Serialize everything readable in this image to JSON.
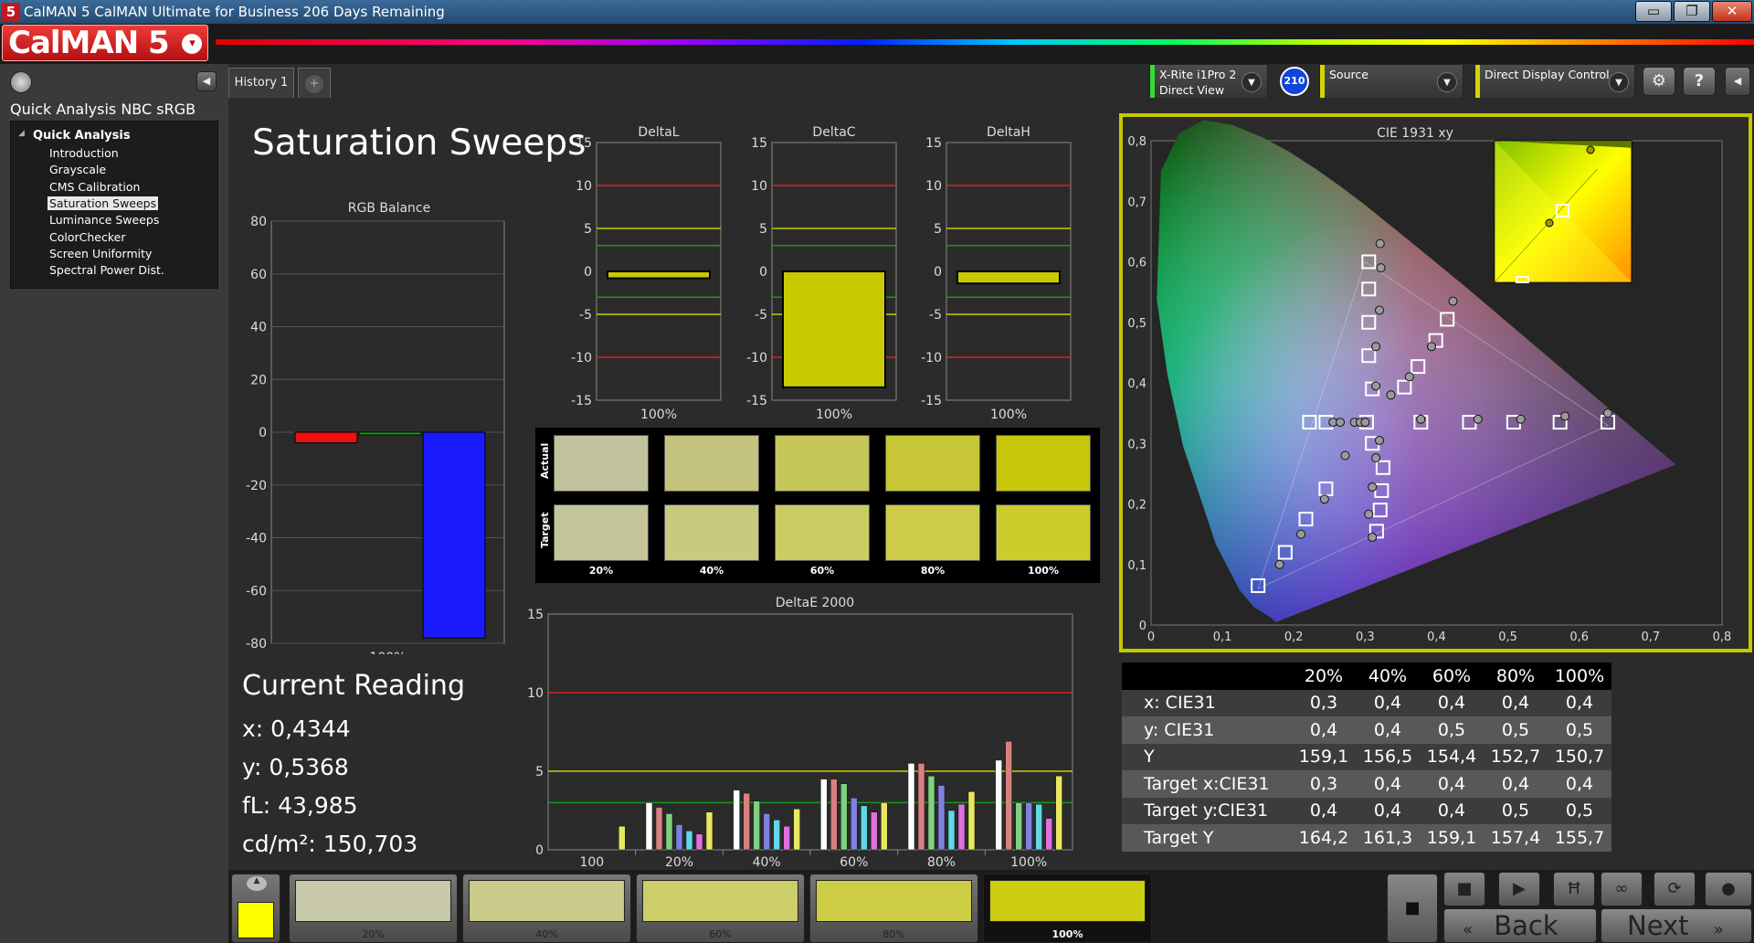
{
  "window": {
    "title": "CalMAN 5 CalMAN Ultimate for Business 206 Days Remaining",
    "app_icon": "5",
    "min": "▭",
    "max": "❐",
    "close": "✕"
  },
  "brand": {
    "logo": "CalMAN 5",
    "menu_glyph": "▾"
  },
  "left_panel": {
    "workflow_title": "Quick Analysis NBC sRGB",
    "tree_root": "Quick Analysis",
    "items": [
      "Introduction",
      "Grayscale",
      "CMS Calibration",
      "Saturation Sweeps",
      "Luminance Sweeps",
      "ColorChecker",
      "Screen Uniformity",
      "Spectral Power Dist."
    ],
    "selected_index": 3
  },
  "tabs": {
    "history": "History 1",
    "add": "+"
  },
  "top_controls": {
    "meter_line1": "X-Rite i1Pro 2",
    "meter_line2": "Direct View",
    "meter_badge": "210",
    "source": "Source",
    "display": "Direct Display Control",
    "stripe_color": "#c7ff00"
  },
  "page_title": "Saturation Sweeps",
  "rgb_balance": {
    "title": "RGB Balance",
    "ticks": [
      "80",
      "60",
      "40",
      "20",
      "0",
      "-20",
      "-40",
      "-60",
      "-80"
    ],
    "xlabel": "100%",
    "values": {
      "red": -4,
      "green": -1,
      "blue": -78
    }
  },
  "delta_charts": [
    {
      "title": "DeltaL",
      "xlabel": "100%",
      "value": -0.8
    },
    {
      "title": "DeltaC",
      "xlabel": "100%",
      "value": -13.5
    },
    {
      "title": "DeltaH",
      "xlabel": "100%",
      "value": -1.4
    }
  ],
  "delta_ticks": [
    "15",
    "10",
    "5",
    "0",
    "-5",
    "-10",
    "-15"
  ],
  "swatches": {
    "actual_label": "Actual",
    "target_label": "Target",
    "labels": [
      "20%",
      "40%",
      "60%",
      "80%",
      "100%"
    ],
    "actual_colors": [
      "#c2c29c",
      "#c3c37d",
      "#c6c65b",
      "#c6c637",
      "#c7c70c"
    ],
    "target_colors": [
      "#c5c59a",
      "#c9c980",
      "#cccc65",
      "#cccc48",
      "#cccc2a"
    ]
  },
  "current_reading": {
    "title": "Current Reading",
    "x": "x: 0,4344",
    "y": "y: 0,5368",
    "fl": "fL: 43,985",
    "cdm2": "cd/m²: 150,703"
  },
  "deltae": {
    "title": "DeltaE 2000",
    "ticks": [
      "15",
      "10",
      "5",
      "0"
    ],
    "categories": [
      "100",
      "20%",
      "40%",
      "60%",
      "80%",
      "100%"
    ],
    "bar_colors": [
      "#ffffff",
      "#d98080",
      "#7fd07f",
      "#8080e0",
      "#60d8e8",
      "#e070e0",
      "#e8e860"
    ],
    "groups": [
      [
        0,
        0,
        0,
        0,
        0,
        0,
        1.5
      ],
      [
        3.0,
        2.7,
        2.3,
        1.6,
        1.2,
        1.0,
        2.4
      ],
      [
        3.8,
        3.6,
        3.1,
        2.3,
        1.9,
        1.5,
        2.6
      ],
      [
        4.5,
        4.5,
        4.2,
        3.3,
        2.8,
        2.4,
        3.0
      ],
      [
        5.5,
        5.5,
        4.7,
        4.1,
        2.5,
        2.9,
        3.7
      ],
      [
        5.7,
        6.9,
        3.0,
        3.0,
        2.9,
        2.0,
        4.7
      ]
    ]
  },
  "cie": {
    "title": "CIE 1931 xy",
    "xticks": [
      "0",
      "0,1",
      "0,2",
      "0,3",
      "0,4",
      "0,5",
      "0,6",
      "0,7",
      "0,8"
    ],
    "yticks": [
      "0",
      "0,1",
      "0,2",
      "0,3",
      "0,4",
      "0,5",
      "0,6",
      "0,7",
      "0,8"
    ]
  },
  "table": {
    "headers": [
      "20%",
      "40%",
      "60%",
      "80%",
      "100%"
    ],
    "rows": [
      {
        "label": "x: CIE31",
        "values": [
          "0,3",
          "0,4",
          "0,4",
          "0,4",
          "0,4"
        ]
      },
      {
        "label": "y: CIE31",
        "values": [
          "0,4",
          "0,4",
          "0,5",
          "0,5",
          "0,5"
        ]
      },
      {
        "label": "Y",
        "values": [
          "159,1",
          "156,5",
          "154,4",
          "152,7",
          "150,7"
        ]
      },
      {
        "label": "Target x:CIE31",
        "values": [
          "0,3",
          "0,4",
          "0,4",
          "0,4",
          "0,4"
        ]
      },
      {
        "label": "Target y:CIE31",
        "values": [
          "0,4",
          "0,4",
          "0,4",
          "0,5",
          "0,5"
        ]
      },
      {
        "label": "Target Y",
        "values": [
          "164,2",
          "161,3",
          "159,1",
          "157,4",
          "155,7"
        ]
      }
    ]
  },
  "bottom": {
    "swatch_labels": [
      "20%",
      "40%",
      "60%",
      "80%",
      "100%"
    ],
    "swatch_colors": [
      "#c8c8aa",
      "#caca8a",
      "#cdcd6a",
      "#cdcd45",
      "#cccc10"
    ],
    "back": "Back",
    "next": "Next"
  }
}
